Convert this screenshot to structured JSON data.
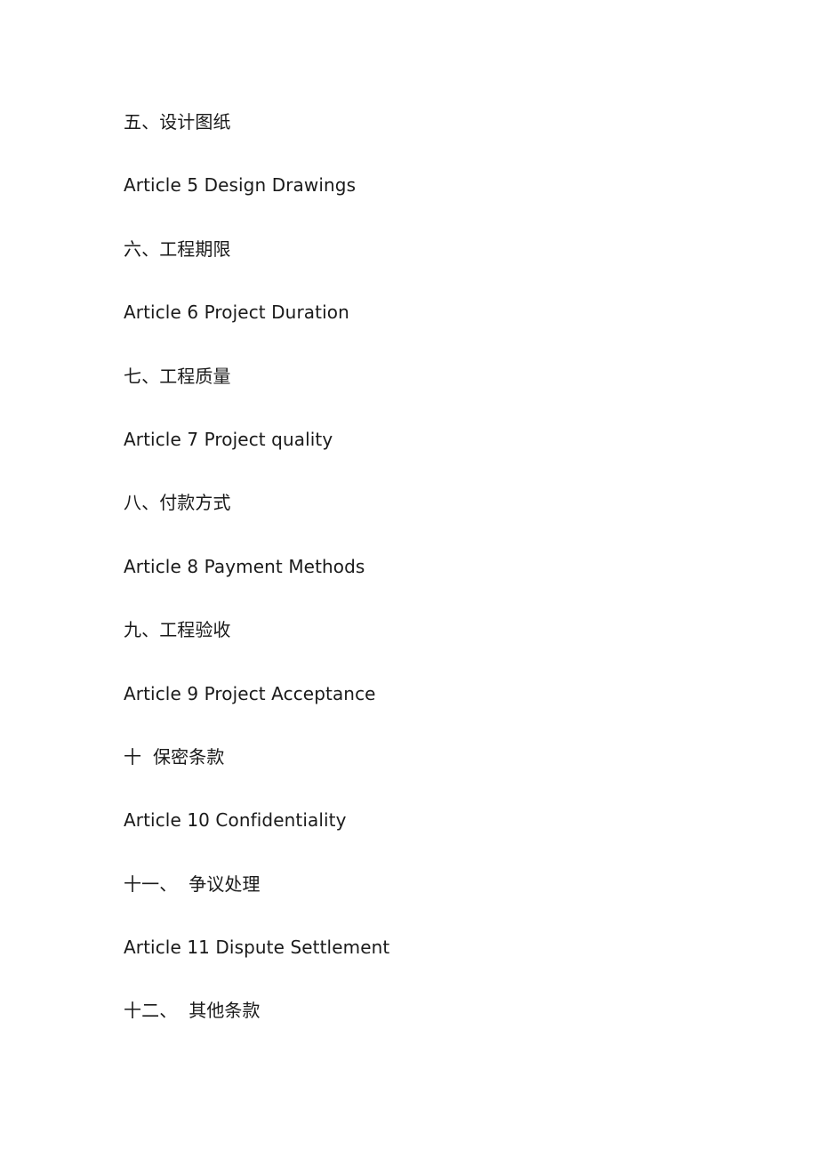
{
  "document": {
    "lines": [
      "五、设计图纸",
      "Article 5 Design Drawings",
      "六、工程期限",
      "Article 6 Project Duration",
      "七、工程质量",
      "Article 7 Project quality",
      "八、付款方式",
      "Article 8 Payment Methods",
      "九、工程验收",
      "Article 9 Project Acceptance",
      "十  保密条款",
      "Article 10 Confidentiality",
      "十一、  争议处理",
      "Article 11 Dispute Settlement",
      "十二、  其他条款"
    ]
  }
}
